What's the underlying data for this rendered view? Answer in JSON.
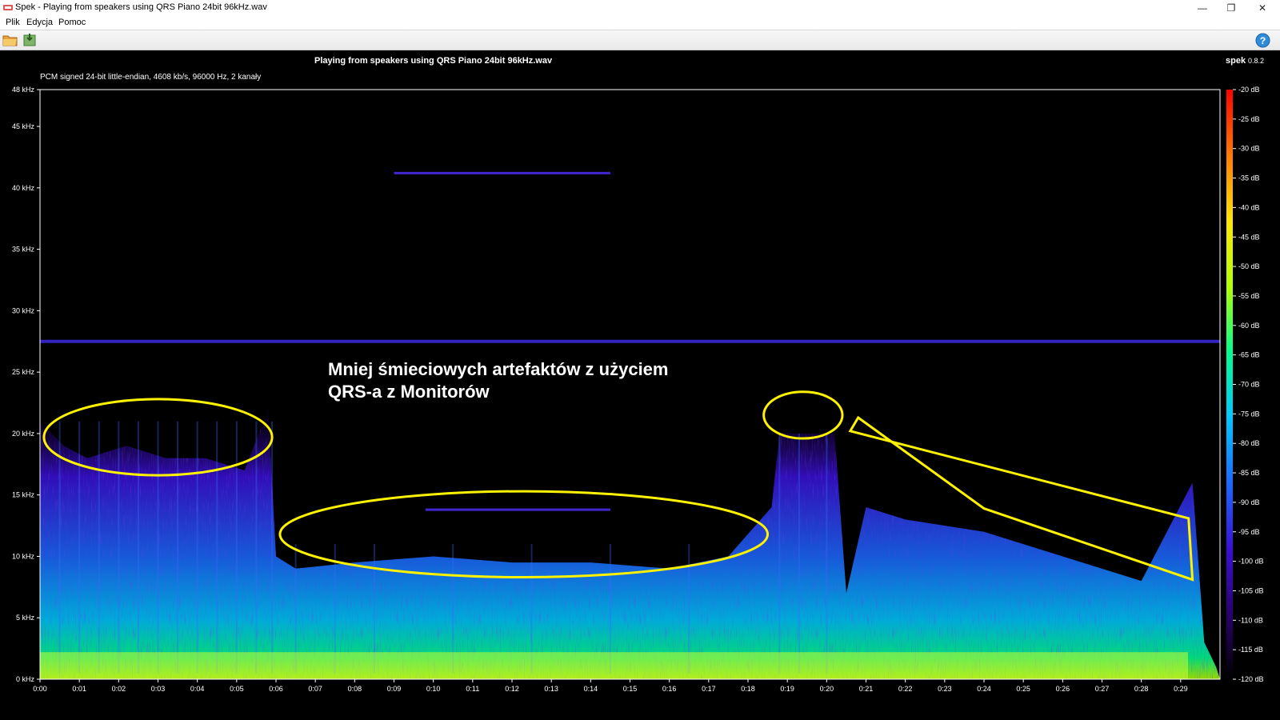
{
  "window": {
    "title": "Spek - Playing from speakers using QRS Piano 24bit 96kHz.wav",
    "controls": {
      "minimize": "—",
      "maximize": "❐",
      "close": "✕"
    }
  },
  "menu": {
    "items": [
      "Plik",
      "Edycja",
      "Pomoc"
    ]
  },
  "toolbar": {
    "icons": [
      "open-file-icon",
      "save-image-icon",
      "help-icon"
    ]
  },
  "header": {
    "file_name": "Playing from speakers using QRS Piano 24bit 96kHz.wav",
    "stream_info": "PCM signed 24-bit little-endian, 4608 kb/s, 96000 Hz, 2 kanały",
    "brand": "spek",
    "version": "0.8.2"
  },
  "annotation": {
    "text_line1": "Mniej śmieciowych artefaktów z użyciem",
    "text_line2": "QRS-a z Monitorów",
    "color": "#FFF200"
  },
  "chart_data": {
    "type": "heatmap",
    "title": "Playing from speakers using QRS Piano 24bit 96kHz.wav",
    "xlabel": "",
    "ylabel": "",
    "x_ticks": [
      "0:00",
      "0:01",
      "0:02",
      "0:03",
      "0:04",
      "0:05",
      "0:06",
      "0:07",
      "0:08",
      "0:09",
      "0:10",
      "0:11",
      "0:12",
      "0:13",
      "0:14",
      "0:15",
      "0:16",
      "0:17",
      "0:18",
      "0:19",
      "0:20",
      "0:21",
      "0:22",
      "0:23",
      "0:24",
      "0:25",
      "0:26",
      "0:27",
      "0:28",
      "0:29"
    ],
    "x_range_seconds": [
      0,
      30
    ],
    "y_ticks": [
      "0 kHz",
      "5 kHz",
      "10 kHz",
      "15 kHz",
      "20 kHz",
      "25 kHz",
      "30 kHz",
      "35 kHz",
      "40 kHz",
      "45 kHz",
      "48 kHz"
    ],
    "y_range_khz": [
      0,
      48
    ],
    "color_scale_ticks": [
      "-20 dB",
      "-25 dB",
      "-30 dB",
      "-35 dB",
      "-40 dB",
      "-45 dB",
      "-50 dB",
      "-55 dB",
      "-60 dB",
      "-65 dB",
      "-70 dB",
      "-75 dB",
      "-80 dB",
      "-85 dB",
      "-90 dB",
      "-95 dB",
      "-100 dB",
      "-105 dB",
      "-110 dB",
      "-115 dB",
      "-120 dB"
    ],
    "db_range": [
      -120,
      -20
    ],
    "colormap": [
      "#000000",
      "#2a0070",
      "#3a10d8",
      "#1a6aff",
      "#00c8ff",
      "#00ff90",
      "#b4ff00",
      "#ffe600",
      "#ff7a00",
      "#ff0000"
    ],
    "features": [
      {
        "kind": "tone",
        "khz": 27.5,
        "start_s": 0,
        "end_s": 30
      },
      {
        "kind": "tone",
        "khz": 41.2,
        "start_s": 9,
        "end_s": 14.5
      },
      {
        "kind": "tone",
        "khz": 13.8,
        "start_s": 9.8,
        "end_s": 14.5
      }
    ],
    "highlights": [
      {
        "shape": "ellipse",
        "t_center_s": 3.0,
        "khz_center": 19.7,
        "t_radius_s": 2.9,
        "khz_radius": 3.1
      },
      {
        "shape": "ellipse",
        "t_center_s": 12.3,
        "khz_center": 11.8,
        "t_radius_s": 6.2,
        "khz_radius": 3.5
      },
      {
        "shape": "ellipse",
        "t_center_s": 19.4,
        "khz_center": 21.5,
        "t_radius_s": 1.0,
        "khz_radius": 1.9
      },
      {
        "shape": "polygon",
        "points_s_khz": [
          [
            20.8,
            21.3
          ],
          [
            24.0,
            13.9
          ],
          [
            29.3,
            8.1
          ],
          [
            29.2,
            13.1
          ],
          [
            20.6,
            20.2
          ]
        ]
      }
    ]
  }
}
